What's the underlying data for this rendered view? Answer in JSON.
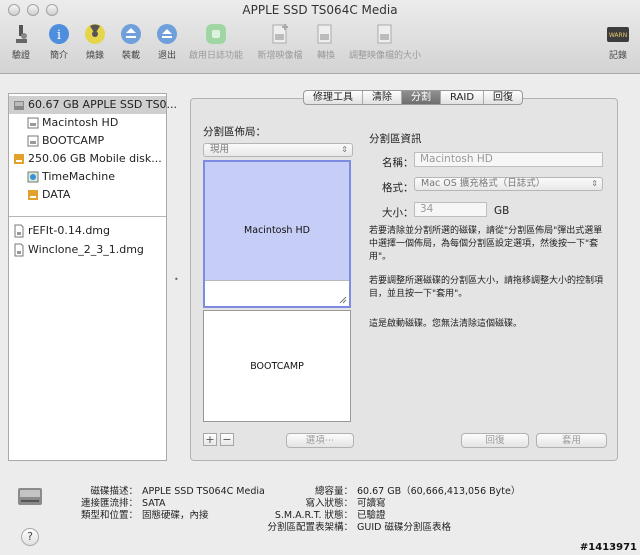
{
  "window": {
    "title": "APPLE SSD TS064C Media"
  },
  "toolbar": {
    "verify": "驗證",
    "info": "簡介",
    "burn": "燒錄",
    "mount": "裝載",
    "eject": "退出",
    "journal": "啟用日誌功能",
    "new_image": "新增映像檔",
    "convert": "轉換",
    "resize_image": "調整映像檔的大小",
    "log": "記錄"
  },
  "sidebar": {
    "items": [
      {
        "label": "60.67 GB APPLE SSD TS0..."
      },
      {
        "label": "Macintosh HD"
      },
      {
        "label": "BOOTCAMP"
      },
      {
        "label": "250.06 GB Mobile disk..."
      },
      {
        "label": "TimeMachine"
      },
      {
        "label": "DATA"
      },
      {
        "label": "rEFIt-0.14.dmg"
      },
      {
        "label": "Winclone_2_3_1.dmg"
      }
    ]
  },
  "tabs": [
    "修理工具",
    "清除",
    "分割",
    "RAID",
    "回復"
  ],
  "partition": {
    "layout_label": "分割區佈局：",
    "layout_value": "現用",
    "partitions": [
      "Macintosh HD",
      "BOOTCAMP"
    ],
    "options_button": "選項⋯",
    "add": "+",
    "remove": "−",
    "info_label": "分割區資訊",
    "name_label": "名稱：",
    "name_value": "Macintosh HD",
    "format_label": "格式：",
    "format_value": "Mac OS 擴充格式（日誌式）",
    "size_label": "大小：",
    "size_value": "34",
    "size_unit": "GB",
    "desc1": "若要清除並分割所選的磁碟，請從\"分割區佈局\"彈出式選單中選擇一個佈局，為每個分割區設定選項，然後按一下\"套用\"。",
    "desc2": "若要調整所選磁碟的分割區大小，請拖移調整大小的控制項目，並且按一下\"套用\"。",
    "desc3": "這是啟動磁碟。您無法清除這個磁碟。",
    "revert": "回復",
    "apply": "套用"
  },
  "info": {
    "desc_label": "磁碟描述：",
    "desc_value": "APPLE SSD TS064C Media",
    "bus_label": "連接匯流排：",
    "bus_value": "SATA",
    "type_label": "類型和位置：",
    "type_value": "固態硬碟，內接",
    "cap_label": "總容量：",
    "cap_value": "60.67 GB（60,666,413,056 Byte）",
    "write_label": "寫入狀態：",
    "write_value": "可讀寫",
    "smart_label": "S.M.A.R.T. 狀態：",
    "smart_value": "已驗證",
    "scheme_label": "分割區配置表架構：",
    "scheme_value": "GUID 磁碟分割區表格"
  },
  "help": "?",
  "watermark": "#1413971"
}
